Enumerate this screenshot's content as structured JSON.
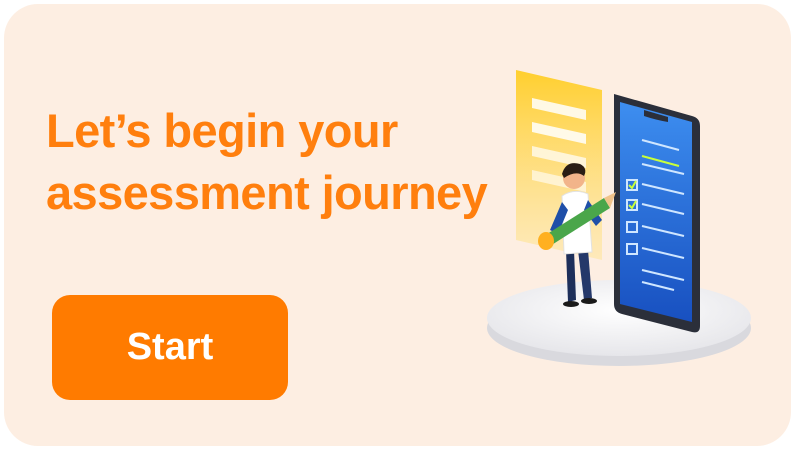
{
  "headline": {
    "line1": "Let’s begin your",
    "line2": "assessment journey"
  },
  "start_button": {
    "label": "Start"
  },
  "colors": {
    "accent": "#ff7f0e",
    "button": "#ff7b00",
    "card_background": "#fdeee2",
    "phone_screen": "#1e64d6",
    "form_panel": "#ffd23f"
  },
  "icons": [
    "assessment-illustration",
    "checkbox-icon",
    "pencil-icon"
  ]
}
